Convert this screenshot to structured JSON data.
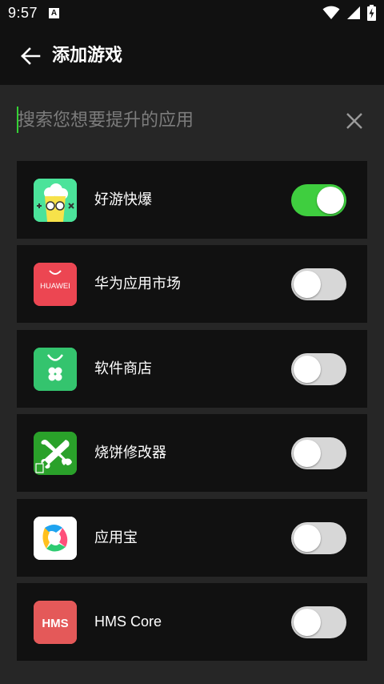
{
  "status_bar": {
    "time": "9:57",
    "notification_icon": "a-letter-icon",
    "icons": [
      "wifi-icon",
      "signal-icon",
      "battery-charging-icon"
    ]
  },
  "app_bar": {
    "title": "添加游戏",
    "back_icon": "arrow-left-icon"
  },
  "search": {
    "placeholder": "搜索您想要提升的应用",
    "value": "",
    "clear_icon": "close-icon"
  },
  "colors": {
    "background": "#262626",
    "card": "#111111",
    "accent": "#3fce3f",
    "toggle_off": "#d7d7d7"
  },
  "apps": [
    {
      "name": "好游快爆",
      "icon": "haoyou-kuaibao-icon",
      "enabled": true
    },
    {
      "name": "华为应用市场",
      "icon": "huawei-appgallery-icon",
      "icon_text": "HUAWEI",
      "enabled": false
    },
    {
      "name": "软件商店",
      "icon": "software-store-icon",
      "enabled": false
    },
    {
      "name": "烧饼修改器",
      "icon": "wrench-icon",
      "enabled": false
    },
    {
      "name": "应用宝",
      "icon": "yingyongbao-icon",
      "enabled": false
    },
    {
      "name": "HMS Core",
      "icon": "hms-core-icon",
      "icon_text": "HMS",
      "enabled": false
    }
  ]
}
